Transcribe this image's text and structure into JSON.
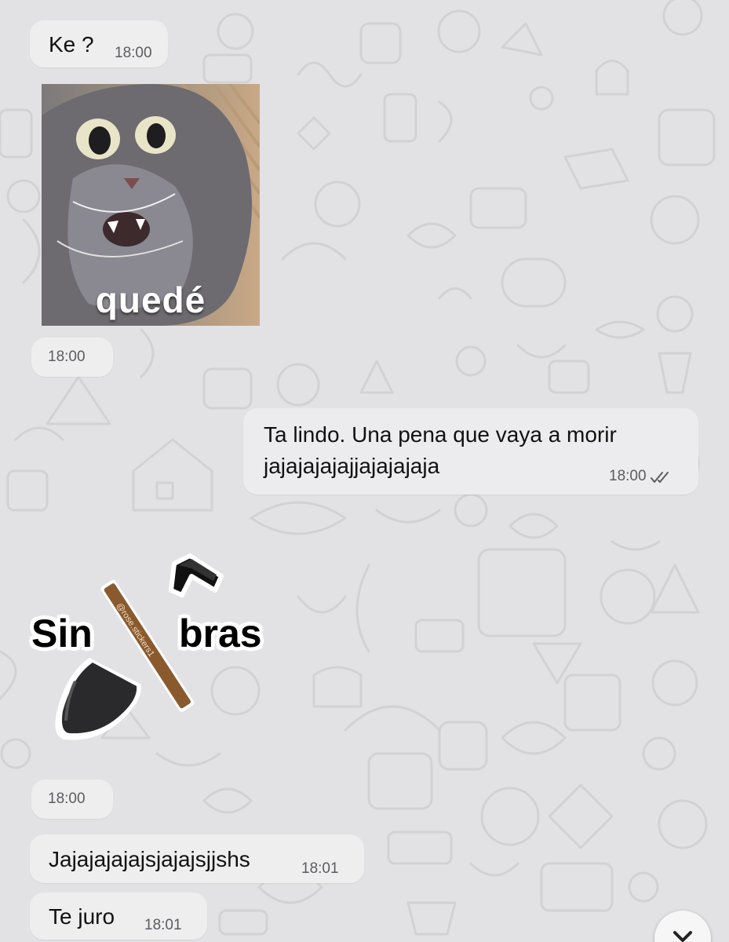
{
  "messages": [
    {
      "text": "Ke ?",
      "time": "18:00"
    },
    {
      "sticker_caption": "quedé",
      "time": "18:00"
    },
    {
      "text": "Ta lindo. Una pena que vaya a morir\njajajajajajjajajajaja",
      "time": "18:00",
      "status": "read"
    },
    {
      "sticker_words": [
        "Sin",
        "bras"
      ],
      "sticker_watermark": "@rose.stickers1",
      "time": "18:00"
    },
    {
      "text": "Jajajajajajsjajajsjjshs",
      "time": "18:01"
    },
    {
      "text": "Te juro",
      "time": "18:01"
    }
  ],
  "icons": {
    "read_receipt": "double-check-icon",
    "scroll": "chevron-down-icon"
  },
  "colors": {
    "background": "#e2e2e4",
    "bubble": "#eeeeef",
    "time_text": "#5c5c60"
  }
}
